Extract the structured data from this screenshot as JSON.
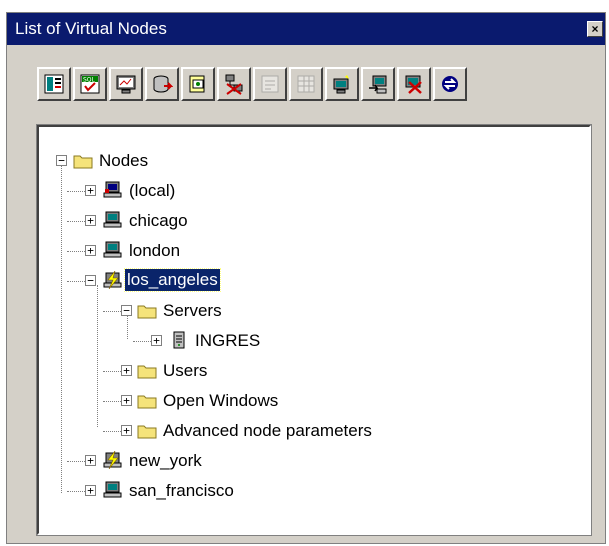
{
  "window": {
    "title": "List of Virtual Nodes",
    "close_glyph": "×"
  },
  "toolbar": {
    "buttons": [
      {
        "icon": "node-properties-icon",
        "enabled": true
      },
      {
        "icon": "sql-test-icon",
        "enabled": true
      },
      {
        "icon": "monitor-icon",
        "enabled": true
      },
      {
        "icon": "database-connect-icon",
        "enabled": true
      },
      {
        "icon": "open-file-icon",
        "enabled": true
      },
      {
        "icon": "node-disconnect-icon",
        "enabled": true
      },
      {
        "icon": "edit-disabled-icon",
        "enabled": false
      },
      {
        "icon": "table-disabled-icon",
        "enabled": false
      },
      {
        "icon": "add-node-icon",
        "enabled": true
      },
      {
        "icon": "alter-node-icon",
        "enabled": true
      },
      {
        "icon": "drop-node-icon",
        "enabled": true
      },
      {
        "icon": "refresh-icon",
        "enabled": true
      }
    ]
  },
  "tree": {
    "root": "Nodes",
    "nodes": [
      {
        "label": "(local)",
        "icon": "local-computer-icon"
      },
      {
        "label": "chicago",
        "icon": "computer-icon"
      },
      {
        "label": "london",
        "icon": "computer-icon"
      },
      {
        "label": "los_angeles",
        "icon": "connected-node-icon",
        "selected": true
      },
      {
        "label": "Servers",
        "icon": "folder-icon"
      },
      {
        "label": "INGRES",
        "icon": "server-icon"
      },
      {
        "label": "Users",
        "icon": "folder-icon"
      },
      {
        "label": "Open Windows",
        "icon": "folder-icon"
      },
      {
        "label": "Advanced node parameters",
        "icon": "folder-icon"
      },
      {
        "label": "new_york",
        "icon": "connected-node-icon"
      },
      {
        "label": "san_francisco",
        "icon": "computer-icon"
      }
    ]
  },
  "colors": {
    "titlebar": "#0a1a6e",
    "selection": "#0a246a",
    "folder": "#f5e37a"
  }
}
